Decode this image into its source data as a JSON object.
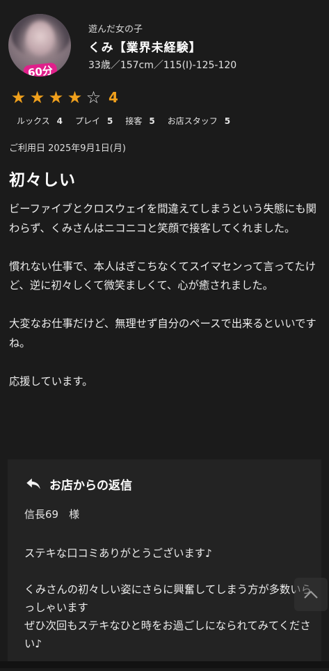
{
  "girl": {
    "play_label": "遊んだ女の子",
    "name": "くみ【業界未経験】",
    "profile": "33歳／157cm／115(I)-125-120",
    "avatar_badge": "60分"
  },
  "rating": {
    "stars_filled": 4,
    "stars_total": 5,
    "value": "4",
    "star_color": "#f0a01c",
    "sub": [
      {
        "label": "ルックス",
        "score": "4"
      },
      {
        "label": "プレイ",
        "score": "5"
      },
      {
        "label": "接客",
        "score": "5"
      },
      {
        "label": "お店スタッフ",
        "score": "5"
      }
    ]
  },
  "review": {
    "date": "ご利用日 2025年9月1日(月)",
    "title": "初々しい",
    "paragraphs": [
      "ビーファイブとクロスウェイを間違えてしまうという失態にも関わらず、くみさんはニコニコと笑顔で接客してくれました。",
      "慣れない仕事で、本人はぎこちなくてスイマセンって言ってたけど、逆に初々しくて微笑ましくて、心が癒されました。",
      "大変なお仕事だけど、無理せず自分のペースで出来るといいですね。",
      "応援しています。"
    ]
  },
  "reply": {
    "title": "お店からの返信",
    "customer": "信長69　様",
    "paragraphs": [
      "ステキな口コミありがとうございます♪",
      "くみさんの初々しい姿にさらに興奮してしまう方が多数いらっしゃいます\nぜひ次回もステキなひと時をお過ごしになられてみてください♪"
    ]
  },
  "icons": {
    "reply": "reply-arrow-icon",
    "scroll_top": "chevron-up-icon"
  }
}
